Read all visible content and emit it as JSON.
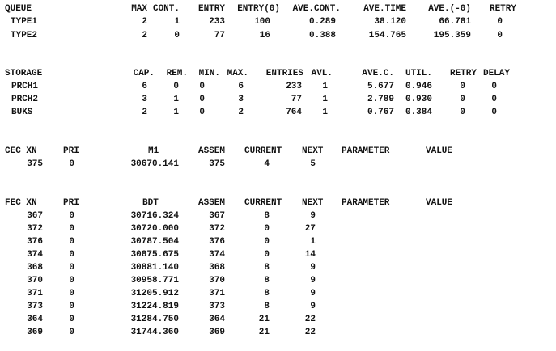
{
  "queue": {
    "headers": [
      "QUEUE",
      "MAX",
      "CONT.",
      "ENTRY",
      "ENTRY(0)",
      "AVE.CONT.",
      "AVE.TIME",
      "AVE.(-0)",
      "RETRY"
    ],
    "rows": [
      [
        "TYPE1",
        "2",
        "1",
        "233",
        "100",
        "0.289",
        "38.120",
        "66.781",
        "0"
      ],
      [
        "TYPE2",
        "2",
        "0",
        "77",
        "16",
        "0.388",
        "154.765",
        "195.359",
        "0"
      ]
    ]
  },
  "storage": {
    "headers": [
      "STORAGE",
      "CAP.",
      "REM.",
      "MIN.",
      "MAX.",
      "ENTRIES",
      "AVL.",
      "AVE.C.",
      "UTIL.",
      "RETRY",
      "DELAY"
    ],
    "rows": [
      [
        "PRCH1",
        "6",
        "0",
        "0",
        "6",
        "233",
        "1",
        "5.677",
        "0.946",
        "0",
        "0"
      ],
      [
        "PRCH2",
        "3",
        "1",
        "0",
        "3",
        "77",
        "1",
        "2.789",
        "0.930",
        "0",
        "0"
      ],
      [
        "BUKS",
        "2",
        "1",
        "0",
        "2",
        "764",
        "1",
        "0.767",
        "0.384",
        "0",
        "0"
      ]
    ]
  },
  "cec": {
    "headers": [
      "CEC XN",
      "PRI",
      "M1",
      "ASSEM",
      "CURRENT",
      "NEXT",
      "PARAMETER",
      "VALUE"
    ],
    "rows": [
      [
        "375",
        "0",
        "30670.141",
        "375",
        "4",
        "5"
      ]
    ]
  },
  "fec": {
    "headers": [
      "FEC XN",
      "PRI",
      "BDT",
      "ASSEM",
      "CURRENT",
      "NEXT",
      "PARAMETER",
      "VALUE"
    ],
    "rows": [
      [
        "367",
        "0",
        "30716.324",
        "367",
        "8",
        "9"
      ],
      [
        "372",
        "0",
        "30720.000",
        "372",
        "0",
        "27"
      ],
      [
        "376",
        "0",
        "30787.504",
        "376",
        "0",
        "1"
      ],
      [
        "374",
        "0",
        "30875.675",
        "374",
        "0",
        "14"
      ],
      [
        "368",
        "0",
        "30881.140",
        "368",
        "8",
        "9"
      ],
      [
        "370",
        "0",
        "30958.771",
        "370",
        "8",
        "9"
      ],
      [
        "371",
        "0",
        "31205.912",
        "371",
        "8",
        "9"
      ],
      [
        "373",
        "0",
        "31224.819",
        "373",
        "8",
        "9"
      ],
      [
        "364",
        "0",
        "31284.750",
        "364",
        "21",
        "22"
      ],
      [
        "369",
        "0",
        "31744.360",
        "369",
        "21",
        "22"
      ]
    ]
  }
}
